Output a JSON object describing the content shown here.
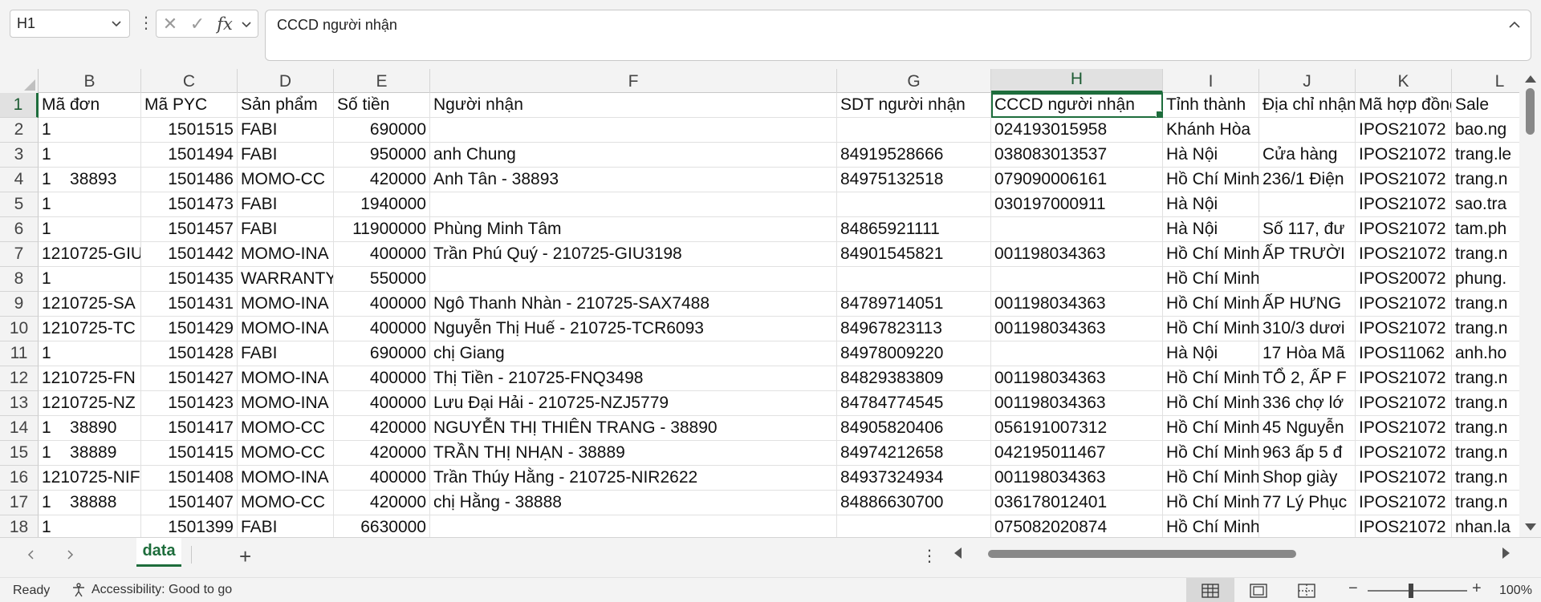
{
  "formula_bar": {
    "name_box": "H1",
    "content": "CCCD người nhận"
  },
  "grid": {
    "active_cell": "H1",
    "columns": [
      {
        "letter": "B",
        "width": 128
      },
      {
        "letter": "C",
        "width": 120
      },
      {
        "letter": "D",
        "width": 120
      },
      {
        "letter": "E",
        "width": 120
      },
      {
        "letter": "F",
        "width": 507
      },
      {
        "letter": "G",
        "width": 192
      },
      {
        "letter": "H",
        "width": 214
      },
      {
        "letter": "I",
        "width": 120
      },
      {
        "letter": "J",
        "width": 120
      },
      {
        "letter": "K",
        "width": 120
      },
      {
        "letter": "L",
        "width": 120
      }
    ],
    "row_numbers": [
      "1",
      "2",
      "3",
      "4",
      "5",
      "6",
      "7",
      "8",
      "9",
      "10",
      "11",
      "12",
      "13",
      "14",
      "15",
      "16",
      "17",
      "18"
    ],
    "numeric_columns": [
      "C",
      "E",
      "B"
    ],
    "rows": [
      [
        "Mã đơn",
        "Mã PYC",
        "Sản phẩm",
        "Số tiền",
        "Người nhận",
        "SDT người nhận",
        "CCCD người nhận",
        "Tỉnh thành",
        "Địa chỉ nhận",
        "Mã hợp đồng",
        "Sale"
      ],
      [
        "1",
        "1501515",
        "FABI",
        "690000",
        "",
        "",
        "024193015958",
        "Khánh Hòa",
        "",
        "IPOS21072",
        "bao.ng"
      ],
      [
        "1",
        "1501494",
        "FABI",
        "950000",
        "anh Chung",
        "84919528666",
        "038083013537",
        "Hà Nội",
        "Cửa hàng",
        "IPOS21072",
        "trang.le"
      ],
      [
        "1    38893",
        "1501486",
        "MOMO-CC",
        "420000",
        "Anh Tân - 38893",
        "84975132518",
        "079090006161",
        "Hồ Chí Minh",
        "236/1 Điện",
        "IPOS21072",
        "trang.n"
      ],
      [
        "1",
        "1501473",
        "FABI",
        "1940000",
        "",
        "",
        "030197000911",
        "Hà Nội",
        "",
        "IPOS21072",
        "sao.tra"
      ],
      [
        "1",
        "1501457",
        "FABI",
        "11900000",
        "Phùng Minh Tâm",
        "84865921111",
        "",
        "Hà Nội",
        "Số 117, đư",
        "IPOS21072",
        "tam.ph"
      ],
      [
        "1210725-GIU",
        "1501442",
        "MOMO-INA",
        "400000",
        "Trần Phú Quý - 210725-GIU3198",
        "84901545821",
        "001198034363",
        "Hồ Chí Minh",
        "ẤP TRƯỜI",
        "IPOS21072",
        "trang.n"
      ],
      [
        "1",
        "1501435",
        "WARRANTY",
        "550000",
        "",
        "",
        "",
        "Hồ Chí Minh",
        "",
        "IPOS20072",
        "phung."
      ],
      [
        "1210725-SA",
        "1501431",
        "MOMO-INA",
        "400000",
        "Ngô Thanh Nhàn - 210725-SAX7488",
        "84789714051",
        "001198034363",
        "Hồ Chí Minh",
        "ẤP HƯNG",
        "IPOS21072",
        "trang.n"
      ],
      [
        "1210725-TC",
        "1501429",
        "MOMO-INA",
        "400000",
        "Nguyễn Thị Huế - 210725-TCR6093",
        "84967823113",
        "001198034363",
        "Hồ Chí Minh",
        "310/3 dươi",
        "IPOS21072",
        "trang.n"
      ],
      [
        "1",
        "1501428",
        "FABI",
        "690000",
        "chị Giang",
        "84978009220",
        "",
        "Hà Nội",
        "17 Hòa Mã",
        "IPOS11062",
        "anh.ho"
      ],
      [
        "1210725-FN",
        "1501427",
        "MOMO-INA",
        "400000",
        "Thị Tiền - 210725-FNQ3498",
        "84829383809",
        "001198034363",
        "Hồ Chí Minh",
        "TỔ 2, ẤP F",
        "IPOS21072",
        "trang.n"
      ],
      [
        "1210725-NZ",
        "1501423",
        "MOMO-INA",
        "400000",
        "Lưu Đại Hải - 210725-NZJ5779",
        "84784774545",
        "001198034363",
        "Hồ Chí Minh",
        "336 chợ lớ",
        "IPOS21072",
        "trang.n"
      ],
      [
        "1    38890",
        "1501417",
        "MOMO-CC",
        "420000",
        "NGUYỄN THỊ THIÊN TRANG - 38890",
        "84905820406",
        "056191007312",
        "Hồ Chí Minh",
        "45 Nguyễn",
        "IPOS21072",
        "trang.n"
      ],
      [
        "1    38889",
        "1501415",
        "MOMO-CC",
        "420000",
        "TRẦN THỊ NHẠN - 38889",
        "84974212658",
        "042195011467",
        "Hồ Chí Minh",
        "963 ấp 5 đ",
        "IPOS21072",
        "trang.n"
      ],
      [
        "1210725-NIF",
        "1501408",
        "MOMO-INA",
        "400000",
        "Trần Thúy Hằng - 210725-NIR2622",
        "84937324934",
        "001198034363",
        "Hồ Chí Minh",
        "Shop giày",
        "IPOS21072",
        "trang.n"
      ],
      [
        "1    38888",
        "1501407",
        "MOMO-CC",
        "420000",
        "chị Hằng - 38888",
        "84886630700",
        "036178012401",
        "Hồ Chí Minh",
        "77 Lý Phục",
        "IPOS21072",
        "trang.n"
      ],
      [
        "1",
        "1501399",
        "FABI",
        "6630000",
        "",
        "",
        "075082020874",
        "Hồ Chí Minh",
        "",
        "IPOS21072",
        "nhan.la"
      ]
    ]
  },
  "sheet_tabs": {
    "active": "data",
    "add_label": "+"
  },
  "status_bar": {
    "ready": "Ready",
    "accessibility": "Accessibility: Good to go",
    "zoom": "100%"
  },
  "colors": {
    "accent": "#1e6d3c",
    "header_bg": "#f3f3f3"
  }
}
